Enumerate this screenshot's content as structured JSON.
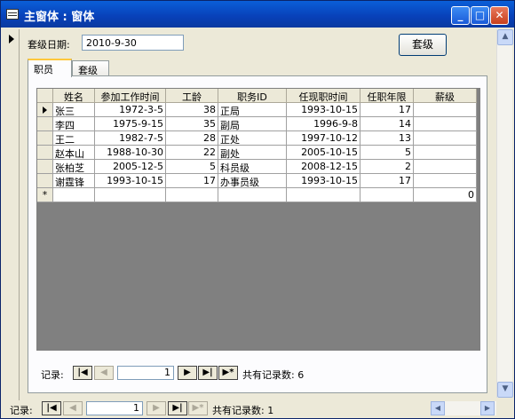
{
  "window": {
    "title": "主窗体 : 窗体",
    "controls": {
      "minimize": "_",
      "maximize": "□",
      "close": "✕"
    }
  },
  "form": {
    "date_label": "套级日期:",
    "date_value": "2010-9-30",
    "grade_button": "套级"
  },
  "tabs": [
    {
      "label": "职员"
    },
    {
      "label": "套级"
    }
  ],
  "grid": {
    "columns": [
      "姓名",
      "参加工作时间",
      "工龄",
      "职务ID",
      "任现职时间",
      "任职年限",
      "薪级"
    ],
    "rows": [
      [
        "张三",
        "1972-3-5",
        "38",
        "正局",
        "1993-10-15",
        "17",
        ""
      ],
      [
        "李四",
        "1975-9-15",
        "35",
        "副局",
        "1996-9-8",
        "14",
        ""
      ],
      [
        "王二",
        "1982-7-5",
        "28",
        "正处",
        "1997-10-12",
        "13",
        ""
      ],
      [
        "赵本山",
        "1988-10-30",
        "22",
        "副处",
        "2005-10-15",
        "5",
        ""
      ],
      [
        "张柏芝",
        "2005-12-5",
        "5",
        "科员级",
        "2008-12-15",
        "2",
        ""
      ],
      [
        "谢霆锋",
        "1993-10-15",
        "17",
        "办事员级",
        "1993-10-15",
        "17",
        ""
      ]
    ],
    "new_row_marker": "*",
    "new_row_value": "0"
  },
  "subform_nav": {
    "label": "记录:",
    "current": "1",
    "total_text": "共有记录数: 6"
  },
  "main_nav": {
    "label": "记录:",
    "current": "1",
    "total_text": "共有记录数: 1"
  }
}
